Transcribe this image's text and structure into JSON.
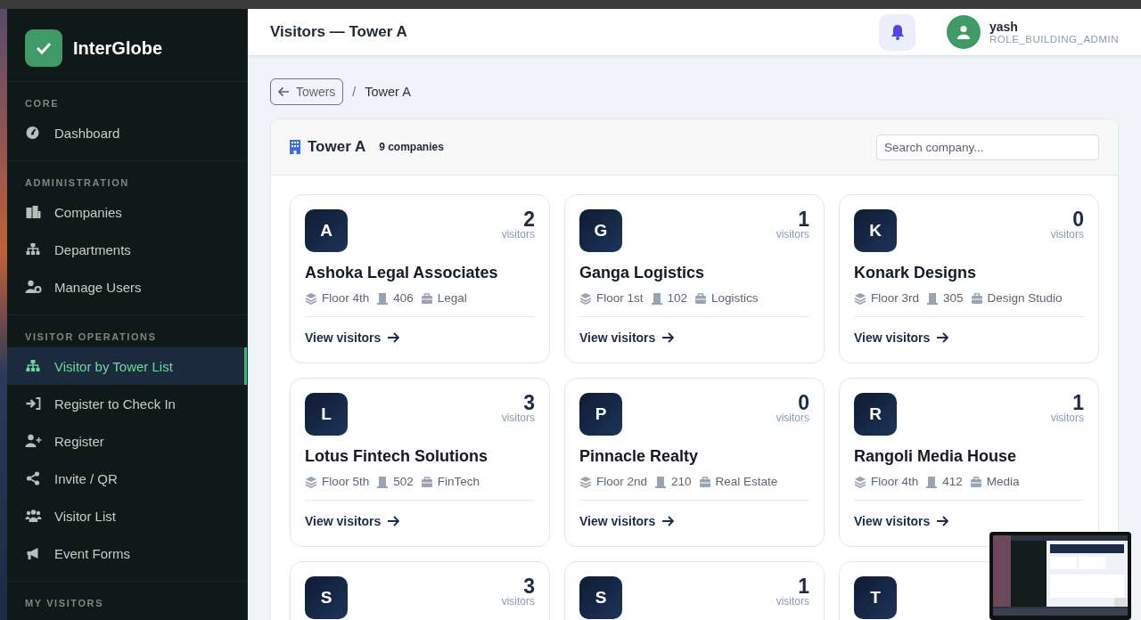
{
  "header": {
    "title": "Visitors — Tower A",
    "user": {
      "name": "yash",
      "role": "ROLE_BUILDING_ADMIN"
    }
  },
  "sidebar": {
    "brand": "InterGlobe",
    "sections": [
      {
        "title": "CORE",
        "items": [
          {
            "label": "Dashboard",
            "selected": false
          }
        ]
      },
      {
        "title": "ADMINISTRATION",
        "items": [
          {
            "label": "Companies",
            "selected": false
          },
          {
            "label": "Departments",
            "selected": false
          },
          {
            "label": "Manage Users",
            "selected": false
          }
        ]
      },
      {
        "title": "VISITOR OPERATIONS",
        "items": [
          {
            "label": "Visitor by Tower List",
            "selected": true
          },
          {
            "label": "Register to Check In",
            "selected": false
          },
          {
            "label": "Register",
            "selected": false
          },
          {
            "label": "Invite / QR",
            "selected": false
          },
          {
            "label": "Visitor List",
            "selected": false
          },
          {
            "label": "Event Forms",
            "selected": false
          }
        ]
      },
      {
        "title": "MY VISITORS"
      }
    ]
  },
  "breadcrumb": {
    "back": "Towers",
    "separator": "/",
    "current": "Tower A"
  },
  "panel": {
    "title": "Tower A",
    "count": "9 companies",
    "search": {
      "placeholder": "Search company..."
    },
    "cards": [
      {
        "initial": "A",
        "count": "2",
        "count_label": "visitors",
        "name": "Ashoka Legal Associates",
        "floor": "Floor 4th",
        "unit": "406",
        "category": "Legal",
        "link": "View visitors"
      },
      {
        "initial": "G",
        "count": "1",
        "count_label": "visitors",
        "name": "Ganga Logistics",
        "floor": "Floor 1st",
        "unit": "102",
        "category": "Logistics",
        "link": "View visitors"
      },
      {
        "initial": "K",
        "count": "0",
        "count_label": "visitors",
        "name": "Konark Designs",
        "floor": "Floor 3rd",
        "unit": "305",
        "category": "Design Studio",
        "link": "View visitors"
      },
      {
        "initial": "L",
        "count": "3",
        "count_label": "visitors",
        "name": "Lotus Fintech Solutions",
        "floor": "Floor 5th",
        "unit": "502",
        "category": "FinTech",
        "link": "View visitors"
      },
      {
        "initial": "P",
        "count": "0",
        "count_label": "visitors",
        "name": "Pinnacle Realty",
        "floor": "Floor 2nd",
        "unit": "210",
        "category": "Real Estate",
        "link": "View visitors"
      },
      {
        "initial": "R",
        "count": "1",
        "count_label": "visitors",
        "name": "Rangoli Media House",
        "floor": "Floor 4th",
        "unit": "412",
        "category": "Media",
        "link": "View visitors"
      },
      {
        "initial": "S",
        "count": "3",
        "count_label": "visitors"
      },
      {
        "initial": "S",
        "count": "1",
        "count_label": "visitors"
      },
      {
        "initial": "T"
      }
    ]
  }
}
